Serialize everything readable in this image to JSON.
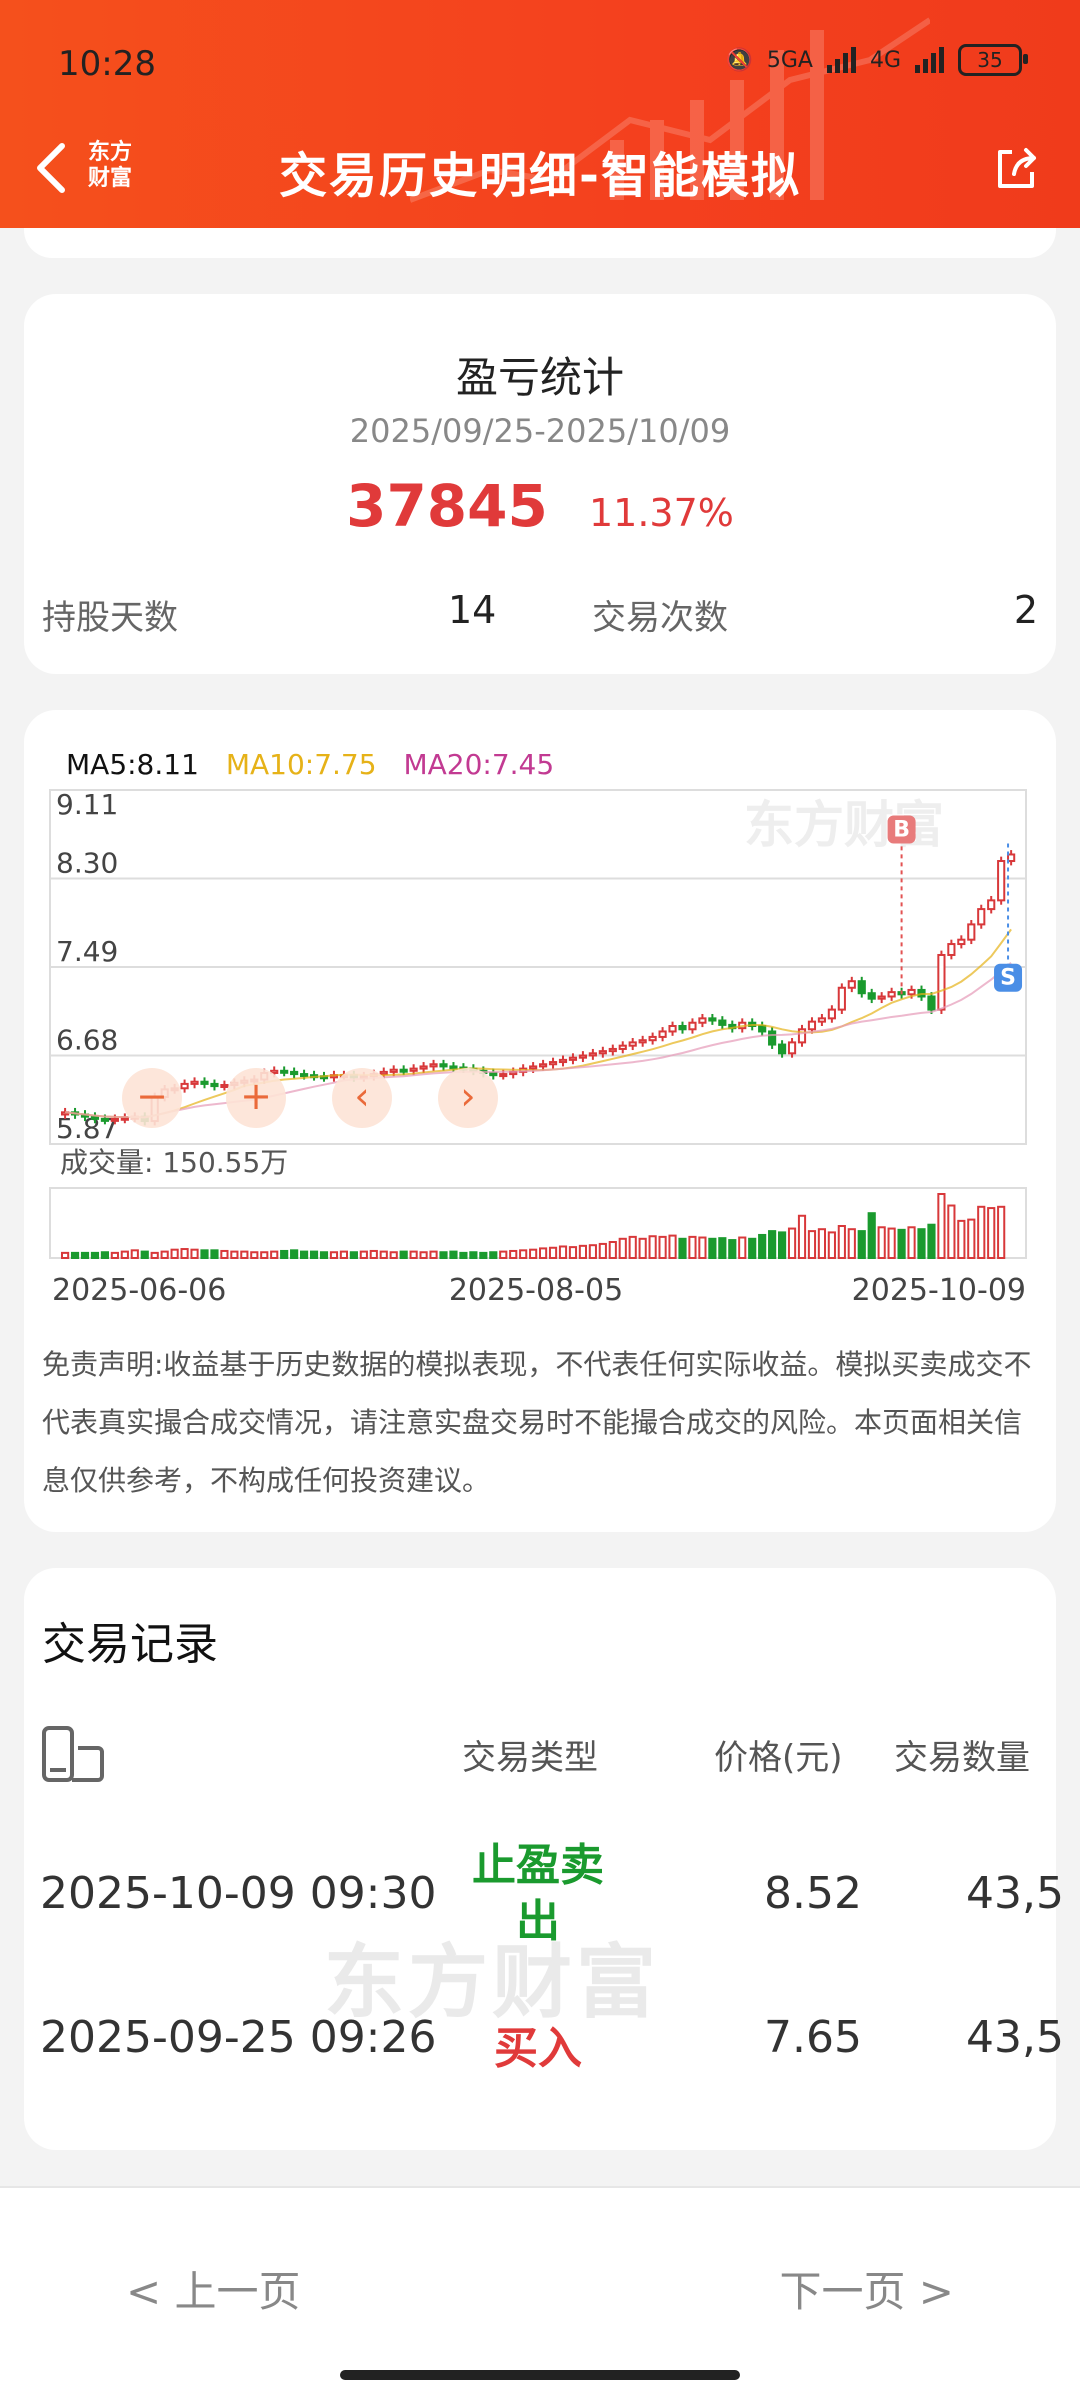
{
  "status": {
    "time": "10:28",
    "net1": "5GA",
    "net2": "4G",
    "battery": "35"
  },
  "header": {
    "logo_line1": "东方",
    "logo_line2": "财富",
    "title": "交易历史明细-智能模拟"
  },
  "stats": {
    "title": "盈亏统计",
    "date_range": "2025/09/25-2025/10/09",
    "profit": "37845",
    "profit_pct": "11.37%",
    "hold_days_label": "持股天数",
    "hold_days": "14",
    "trade_count_label": "交易次数",
    "trade_count": "2"
  },
  "chart_data": {
    "type": "candlestick",
    "ma": {
      "ma5": "MA5:8.11",
      "ma10": "MA10:7.75",
      "ma20": "MA20:7.45"
    },
    "y_ticks": [
      "9.11",
      "8.30",
      "7.49",
      "6.68",
      "5.87"
    ],
    "ylim": [
      5.87,
      9.11
    ],
    "x_ticks": [
      "2025-06-06",
      "2025-08-05",
      "2025-10-09"
    ],
    "volume_label": "成交量: 150.55万",
    "watermark": "东方财富",
    "markers": {
      "buy": "B",
      "sell": "S"
    },
    "closes": [
      6.16,
      6.14,
      6.12,
      6.1,
      6.09,
      6.1,
      6.11,
      6.12,
      6.08,
      6.3,
      6.37,
      6.38,
      6.42,
      6.44,
      6.42,
      6.4,
      6.41,
      6.43,
      6.45,
      6.46,
      6.52,
      6.54,
      6.53,
      6.51,
      6.5,
      6.49,
      6.48,
      6.5,
      6.5,
      6.48,
      6.49,
      6.51,
      6.53,
      6.55,
      6.54,
      6.56,
      6.58,
      6.6,
      6.58,
      6.57,
      6.56,
      6.54,
      6.52,
      6.5,
      6.51,
      6.53,
      6.56,
      6.58,
      6.6,
      6.62,
      6.64,
      6.66,
      6.68,
      6.7,
      6.72,
      6.74,
      6.77,
      6.8,
      6.82,
      6.85,
      6.9,
      6.95,
      6.92,
      6.98,
      7.02,
      7.0,
      6.96,
      6.93,
      6.98,
      6.95,
      6.9,
      6.78,
      6.7,
      6.8,
      6.92,
      6.99,
      7.02,
      7.1,
      7.3,
      7.36,
      7.25,
      7.2,
      7.22,
      7.26,
      7.24,
      7.28,
      7.22,
      7.1,
      7.6,
      7.7,
      7.74,
      7.88,
      8.02,
      8.1,
      8.46,
      8.52
    ],
    "volumes": [
      0.08,
      0.08,
      0.08,
      0.08,
      0.09,
      0.08,
      0.1,
      0.12,
      0.1,
      0.08,
      0.1,
      0.13,
      0.14,
      0.13,
      0.12,
      0.12,
      0.11,
      0.1,
      0.1,
      0.09,
      0.09,
      0.1,
      0.11,
      0.12,
      0.1,
      0.1,
      0.09,
      0.09,
      0.1,
      0.09,
      0.1,
      0.11,
      0.1,
      0.09,
      0.1,
      0.1,
      0.09,
      0.1,
      0.09,
      0.1,
      0.08,
      0.09,
      0.08,
      0.09,
      0.1,
      0.11,
      0.12,
      0.13,
      0.15,
      0.16,
      0.18,
      0.17,
      0.19,
      0.2,
      0.22,
      0.25,
      0.3,
      0.33,
      0.3,
      0.34,
      0.33,
      0.35,
      0.3,
      0.33,
      0.32,
      0.3,
      0.31,
      0.28,
      0.32,
      0.3,
      0.36,
      0.42,
      0.4,
      0.46,
      0.66,
      0.42,
      0.45,
      0.4,
      0.5,
      0.45,
      0.42,
      0.7,
      0.48,
      0.46,
      0.44,
      0.48,
      0.45,
      0.52,
      1.0,
      0.82,
      0.58,
      0.6,
      0.8,
      0.78,
      0.8
    ]
  },
  "disclaimer": "免责声明:收益基于历史数据的模拟表现，不代表任何实际收益。模拟买卖成交不代表真实撮合成交情况，请注意实盘交易时不能撮合成交的风险。本页面相关信息仅供参考，不构成任何投资建议。",
  "records": {
    "title": "交易记录",
    "headers": {
      "type": "交易类型",
      "price": "价格(元)",
      "qty": "交易数量"
    },
    "rows": [
      {
        "time": "2025-10-09 09:30",
        "type": "止盈卖出",
        "price": "8.52",
        "qty": "43,5"
      },
      {
        "time": "2025-09-25 09:26",
        "type": "买入",
        "price": "7.65",
        "qty": "43,5"
      }
    ],
    "watermark": "东方财富"
  },
  "pager": {
    "prev": "<   上一页",
    "next": "下一页   >"
  }
}
